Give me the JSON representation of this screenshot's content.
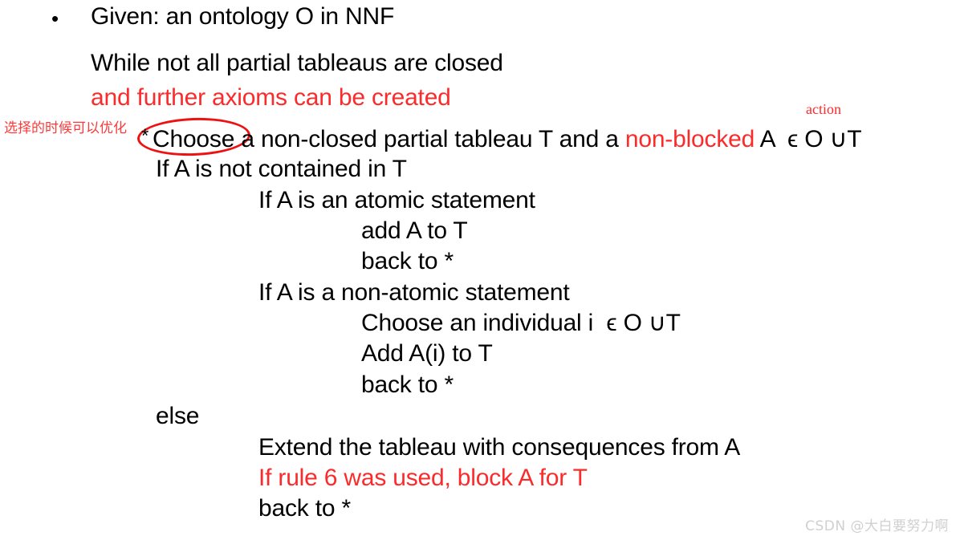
{
  "slide": {
    "background_color": "#ffffff",
    "text_color": "#000000",
    "accent_color": "#fc2b2b",
    "watermark": "CSDN @大白要努力啊",
    "bullet_glyph": "•",
    "star_glyph": "*",
    "annotation_cn": "选择的时候可以优化",
    "action_label": "action"
  },
  "lines": {
    "given": "Given: an ontology O in NNF",
    "while": "While not all partial tableaus are closed",
    "and_further": "and further axioms can be created",
    "choose_pre": "Choose a non-closed partial tableau T and a ",
    "choose_red": "non-blocked",
    "choose_post": " A  ϵ O ∪T",
    "if_not_contained": "If A is not contained in T",
    "if_atomic": "If A is an atomic statement",
    "add_a_to_t": "add A to T",
    "back_to_star_1": "back to *",
    "if_non_atomic": "If A is a non-atomic statement",
    "choose_individual": "Choose an individual i  ϵ O ∪T",
    "add_ai_to_t": "Add A(i) to T",
    "back_to_star_2": "back to *",
    "else": "else",
    "extend": "Extend the tableau with consequences from A",
    "if_rule_6": "If rule 6 was used, block A for T",
    "back_to_star_3": "back to *"
  }
}
